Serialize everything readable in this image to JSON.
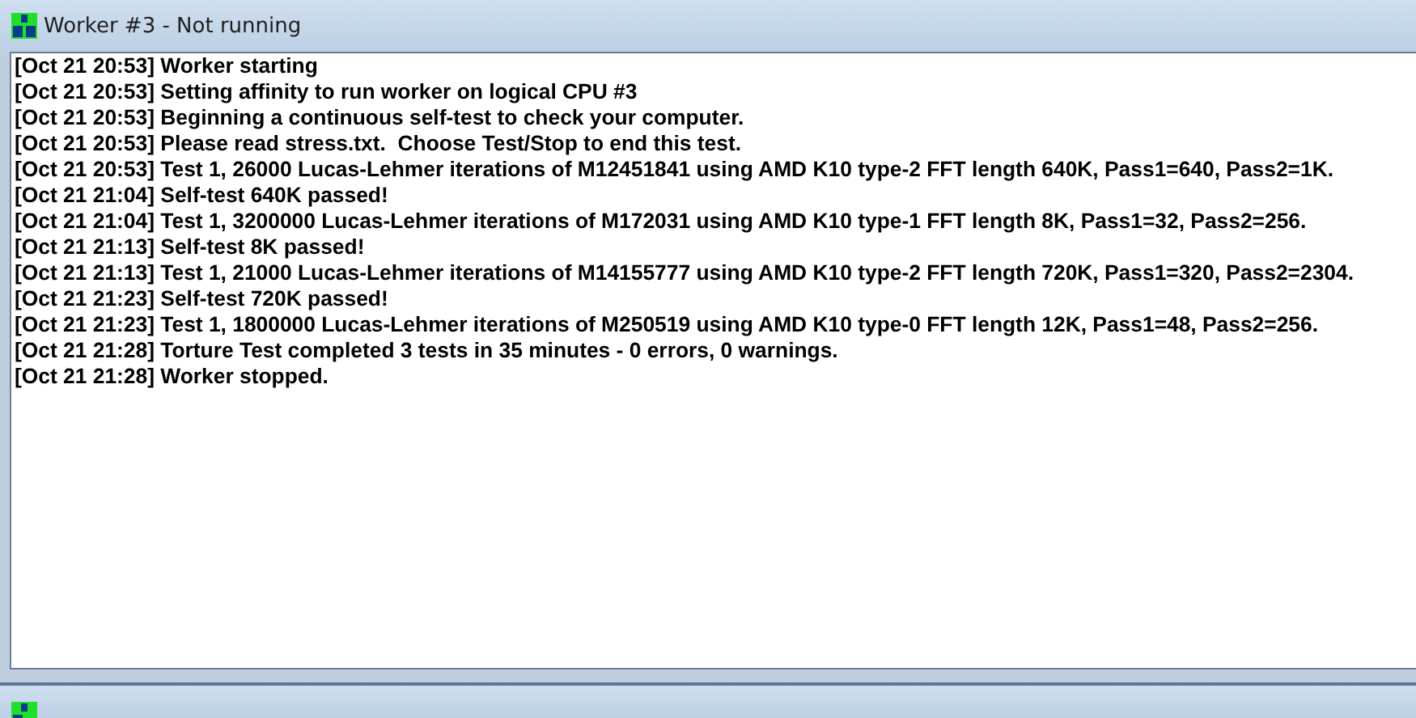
{
  "windows": [
    {
      "title": "Worker #3 - Not running",
      "log": [
        "[Oct 21 20:53] Worker starting",
        "[Oct 21 20:53] Setting affinity to run worker on logical CPU #3",
        "[Oct 21 20:53] Beginning a continuous self-test to check your computer.",
        "[Oct 21 20:53] Please read stress.txt.  Choose Test/Stop to end this test.",
        "[Oct 21 20:53] Test 1, 26000 Lucas-Lehmer iterations of M12451841 using AMD K10 type-2 FFT length 640K, Pass1=640, Pass2=1K.",
        "[Oct 21 21:04] Self-test 640K passed!",
        "[Oct 21 21:04] Test 1, 3200000 Lucas-Lehmer iterations of M172031 using AMD K10 type-1 FFT length 8K, Pass1=32, Pass2=256.",
        "[Oct 21 21:13] Self-test 8K passed!",
        "[Oct 21 21:13] Test 1, 21000 Lucas-Lehmer iterations of M14155777 using AMD K10 type-2 FFT length 720K, Pass1=320, Pass2=2304.",
        "[Oct 21 21:23] Self-test 720K passed!",
        "[Oct 21 21:23] Test 1, 1800000 Lucas-Lehmer iterations of M250519 using AMD K10 type-0 FFT length 12K, Pass1=48, Pass2=256.",
        "[Oct 21 21:28] Torture Test completed 3 tests in 35 minutes - 0 errors, 0 warnings.",
        "[Oct 21 21:28] Worker stopped."
      ]
    },
    {
      "kind": "collapsed"
    }
  ]
}
